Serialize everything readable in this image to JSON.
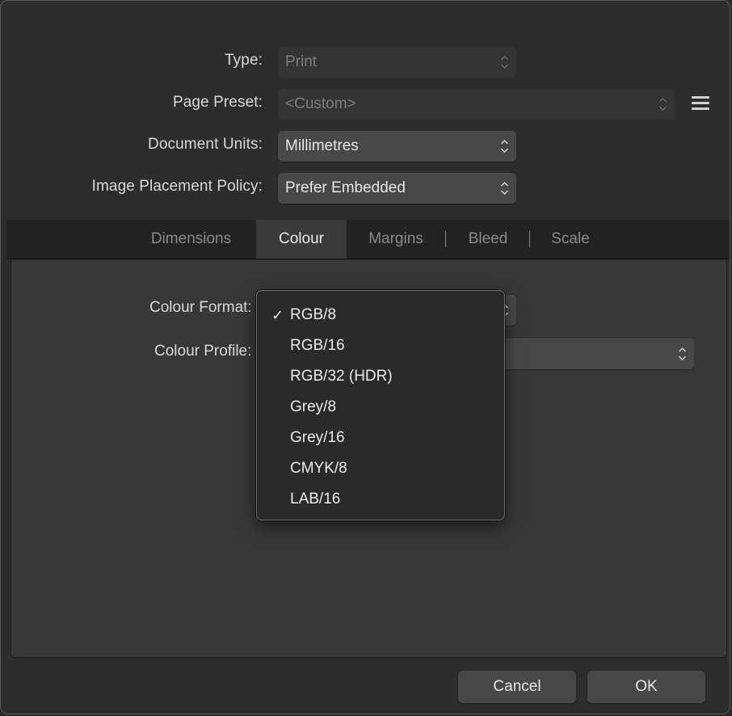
{
  "form": {
    "type": {
      "label": "Type:",
      "value": "Print"
    },
    "page_preset": {
      "label": "Page Preset:",
      "value": "<Custom>"
    },
    "document_units": {
      "label": "Document Units:",
      "value": "Millimetres"
    },
    "image_placement_policy": {
      "label": "Image Placement Policy:",
      "value": "Prefer Embedded"
    }
  },
  "preset_menu_icon": "hamburger-menu-icon",
  "tabs": [
    {
      "label": "Dimensions",
      "active": false
    },
    {
      "label": "Colour",
      "active": true
    },
    {
      "label": "Margins",
      "active": false
    },
    {
      "label": "Bleed",
      "active": false
    },
    {
      "label": "Scale",
      "active": false
    }
  ],
  "colour_panel": {
    "colour_format_label": "Colour Format:",
    "colour_profile_label": "Colour Profile:"
  },
  "colour_format_menu": {
    "items": [
      "RGB/8",
      "RGB/16",
      "RGB/32 (HDR)",
      "Grey/8",
      "Grey/16",
      "CMYK/8",
      "LAB/16"
    ],
    "selected": "RGB/8",
    "check_glyph": "✓"
  },
  "buttons": {
    "cancel": "Cancel",
    "ok": "OK"
  },
  "colors": {
    "dialog_bg": "#2d2d2d",
    "panel_bg": "#383838",
    "tabbar_bg": "#222222",
    "control_bg": "#484848",
    "text": "#e6e6e6",
    "disabled_text": "#7e7e7e"
  }
}
